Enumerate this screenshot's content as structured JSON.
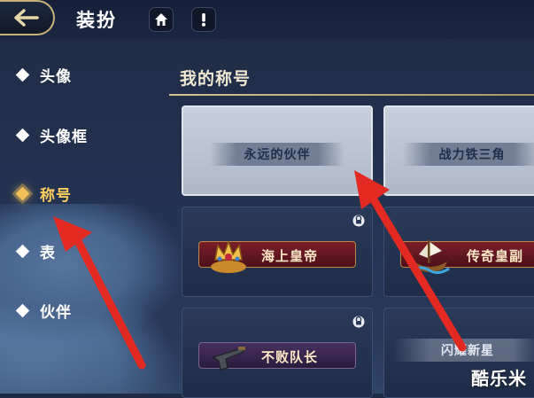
{
  "header": {
    "title": "装扮"
  },
  "sidebar": {
    "items": [
      {
        "label": "头像",
        "active": false
      },
      {
        "label": "头像框",
        "active": false
      },
      {
        "label": "称号",
        "active": true
      },
      {
        "label": "表",
        "active": false
      },
      {
        "label": "伙伴",
        "active": false
      }
    ]
  },
  "section": {
    "title": "我的称号"
  },
  "titles": [
    {
      "label": "永远的伙伴",
      "style": "plain",
      "selected": true,
      "locked": false
    },
    {
      "label": "战力铁三角",
      "style": "plain",
      "selected": false,
      "locked": false
    },
    {
      "label": "海上皇帝",
      "style": "badge-red",
      "icon": "crown-treasure-icon",
      "locked": true
    },
    {
      "label": "传奇皇副",
      "style": "badge-red",
      "icon": "ship-icon",
      "locked": false
    },
    {
      "label": "不败队长",
      "style": "badge-dark",
      "icon": "pistol-icon",
      "locked": true
    },
    {
      "label": "闪耀新星",
      "style": "badge-light",
      "locked": false
    }
  ],
  "watermark": "酷乐米",
  "colors": {
    "accent_gold": "#f1c15a",
    "active_label": "#ffcf5e",
    "annotation_red": "#e32a22"
  }
}
